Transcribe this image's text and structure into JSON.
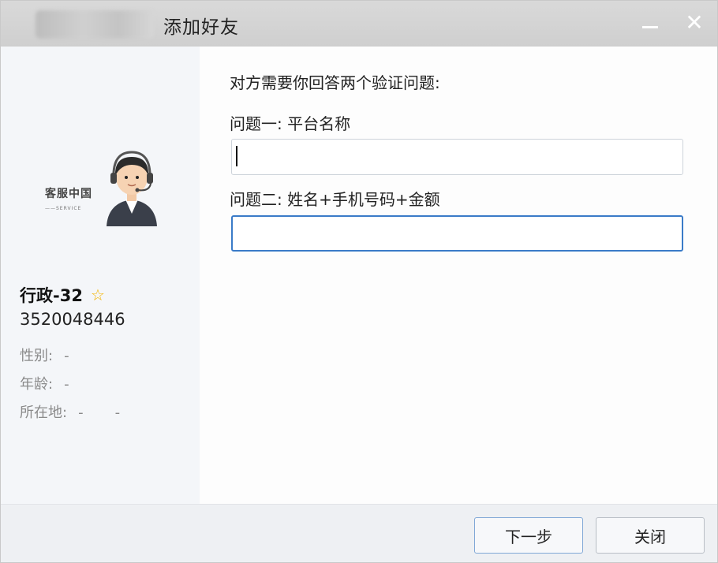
{
  "window": {
    "title": "添加好友"
  },
  "profile": {
    "brand_text": "客服中国",
    "brand_subtext": "——SERVICE",
    "nickname": "行政-32",
    "account_id": "3520048446",
    "fields": [
      {
        "label": "性别:",
        "value": "-"
      },
      {
        "label": "年龄:",
        "value": "-"
      },
      {
        "label": "所在地:",
        "value": "-       -"
      }
    ]
  },
  "verification": {
    "prompt": "对方需要你回答两个验证问题:",
    "question1": {
      "label": "问题一: 平台名称",
      "value": ""
    },
    "question2": {
      "label": "问题二: 姓名+手机号码+金额",
      "value": ""
    }
  },
  "footer": {
    "next_label": "下一步",
    "close_label": "关闭"
  },
  "colors": {
    "star": "#f4b400",
    "focus_border": "#3a7bc8",
    "titlebar": "#d4d4d4"
  }
}
